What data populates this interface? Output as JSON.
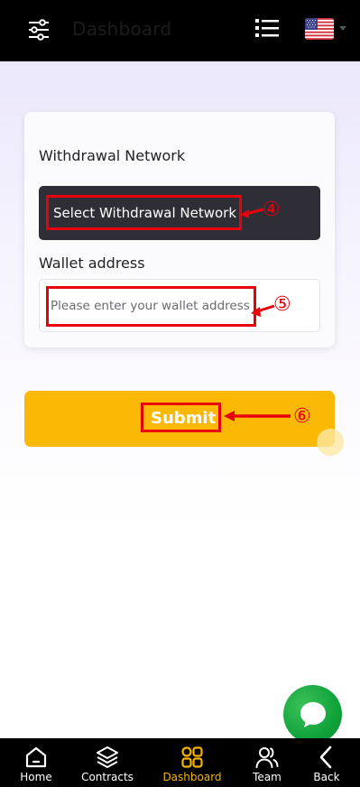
{
  "header": {
    "title": "Dashboard",
    "filter_icon": "sliders-icon",
    "menu_icon": "list-icon",
    "language_flag": "us-flag-icon"
  },
  "form": {
    "network_label": "Withdrawal Network",
    "network_select_text": "Select Withdrawal Network",
    "wallet_label": "Wallet address",
    "wallet_placeholder": "Please enter your wallet address",
    "wallet_value": ""
  },
  "submit": {
    "label": "Submit"
  },
  "annotations": [
    {
      "number": "④"
    },
    {
      "number": "⑤"
    },
    {
      "number": "⑥"
    }
  ],
  "bottom_nav": {
    "items": [
      {
        "label": "Home",
        "icon": "home-icon"
      },
      {
        "label": "Contracts",
        "icon": "layers-icon"
      },
      {
        "label": "Dashboard",
        "icon": "grid-icon",
        "active": true
      },
      {
        "label": "Team",
        "icon": "users-icon"
      },
      {
        "label": "Back",
        "icon": "chevron-left-icon"
      }
    ]
  },
  "colors": {
    "accent": "#fbb805",
    "active_nav": "#f5b400",
    "annotation": "#e8000b",
    "chat": "#11a33b"
  }
}
